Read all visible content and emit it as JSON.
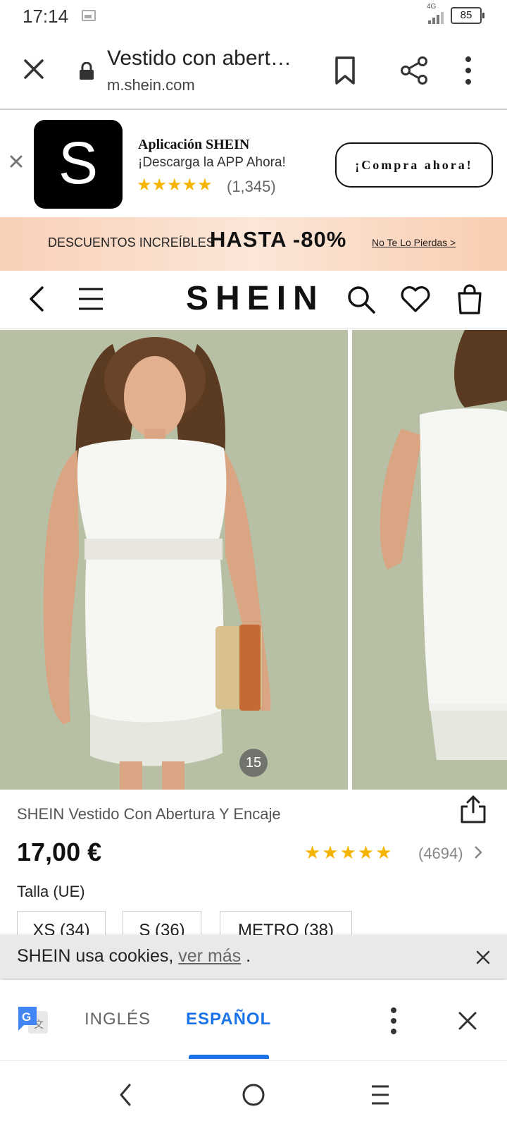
{
  "status": {
    "time": "17:14",
    "network": "4G",
    "battery": "85"
  },
  "urlbar": {
    "title": "Vestido con abert…",
    "domain": "m.shein.com"
  },
  "app_banner": {
    "name": "Aplicación SHEIN",
    "subtitle": "¡Descarga la APP Ahora!",
    "stars": "★★★★★",
    "rating_count": "(1,345)",
    "logo_letter": "S",
    "cta": "¡Compra ahora!"
  },
  "promo": {
    "text": "DESCUENTOS INCREÍBLES",
    "highlight": "HASTA -80%",
    "link": "No Te Lo Pierdas >"
  },
  "nav": {
    "logo": "SHEIN"
  },
  "gallery": {
    "count": "15"
  },
  "product": {
    "title": "SHEIN Vestido Con Abertura Y Encaje",
    "price": "17,00 €",
    "rating_stars": "★★★★★",
    "rating_value": 4.5,
    "rating_count": "(4694)",
    "size_label": "Talla (UE)",
    "sizes": [
      "XS (34)",
      "S (36)",
      "METRO (38)"
    ]
  },
  "cookie": {
    "text": "SHEIN usa cookies, ",
    "link": "ver más",
    "suffix": " ."
  },
  "translate": {
    "lang_from": "INGLÉS",
    "lang_to": "ESPAÑOL",
    "selected": "ESPAÑOL"
  },
  "colors": {
    "accent_blue": "#1a73e8",
    "star_yellow": "#f5b400",
    "photo_bg": "#b7c0a4"
  }
}
